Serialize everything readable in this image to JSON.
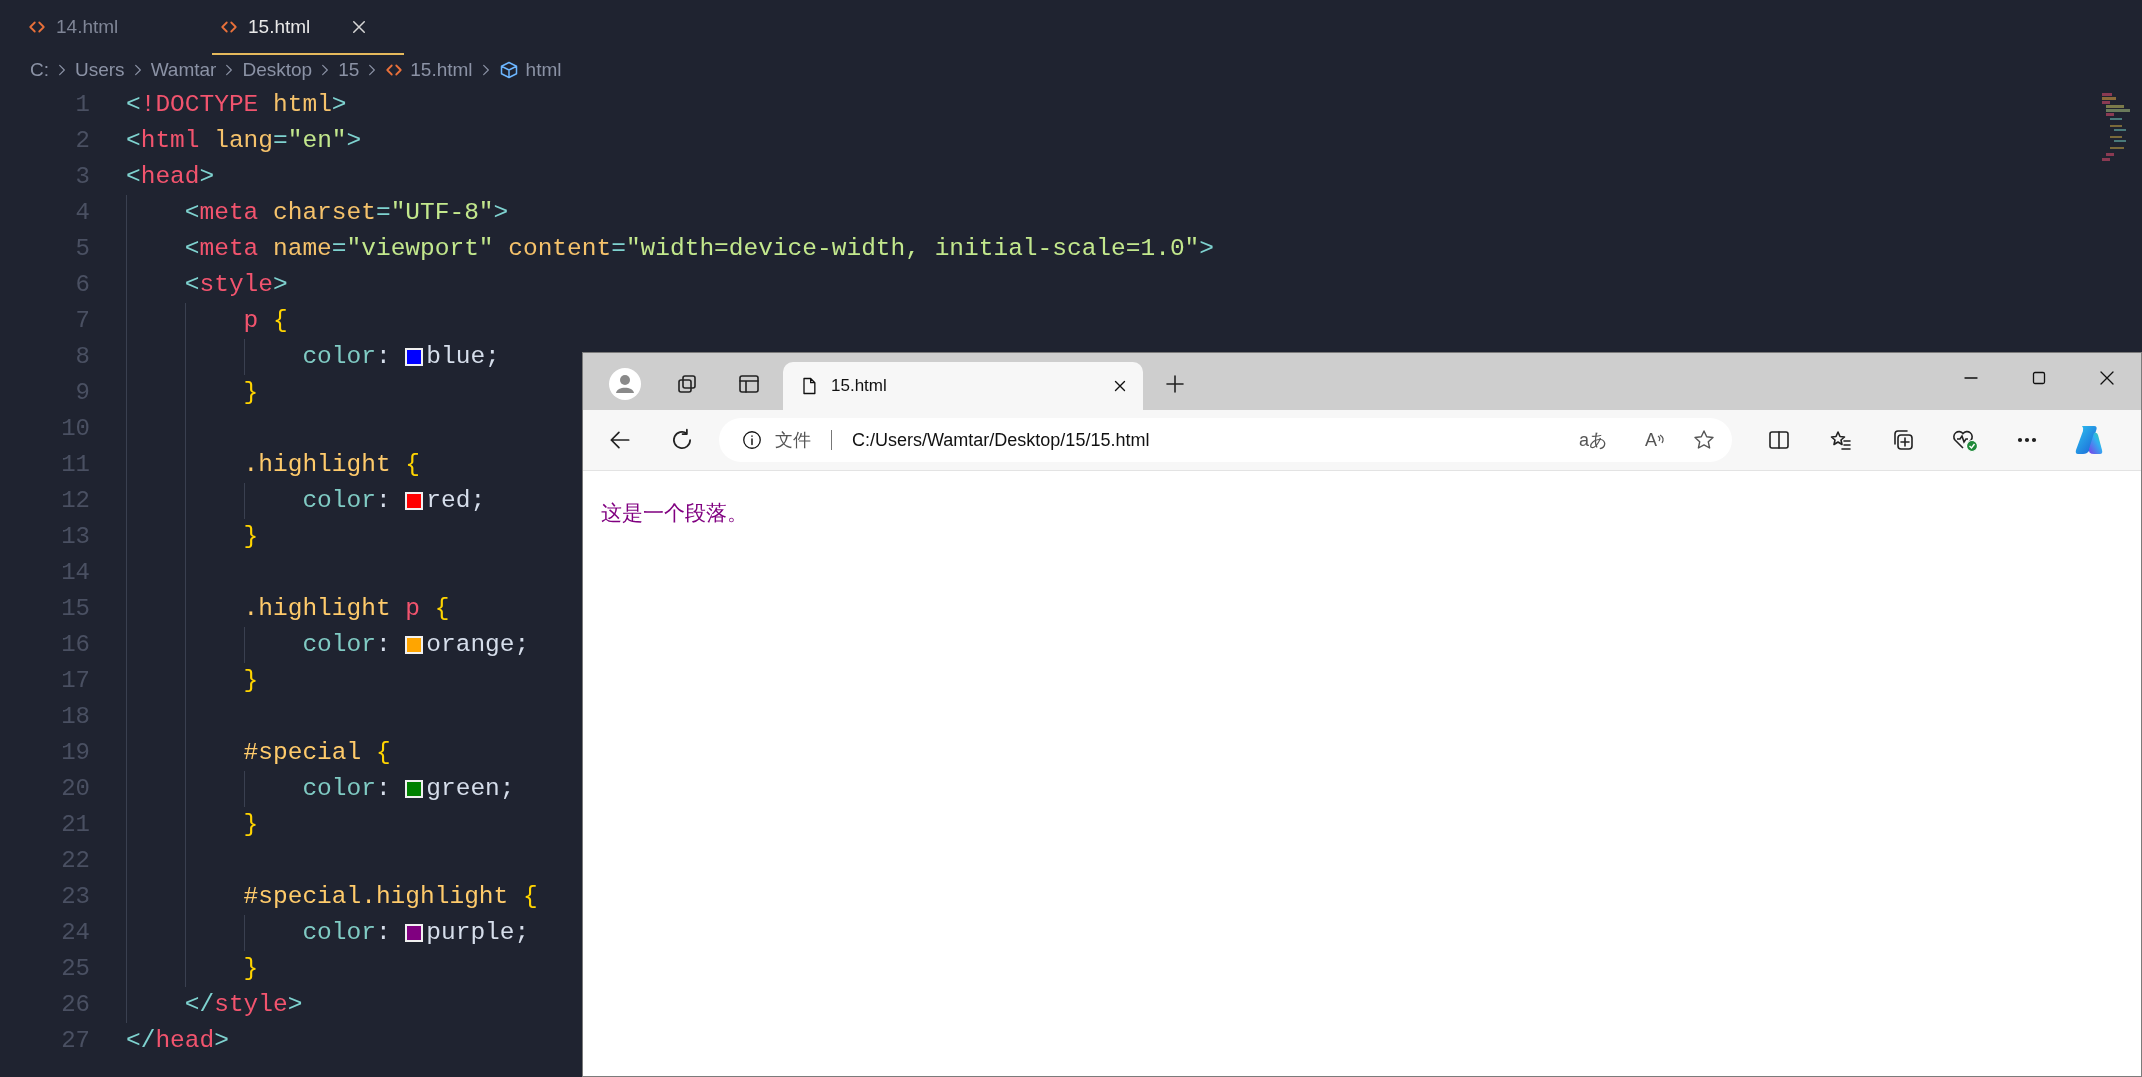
{
  "editor": {
    "tabs": [
      {
        "label": "14.html",
        "selected": false
      },
      {
        "label": "15.html",
        "selected": true
      }
    ],
    "breadcrumb": [
      {
        "label": "C:",
        "kind": "folder"
      },
      {
        "label": "Users",
        "kind": "folder"
      },
      {
        "label": "Wamtar",
        "kind": "folder"
      },
      {
        "label": "Desktop",
        "kind": "folder"
      },
      {
        "label": "15",
        "kind": "folder"
      },
      {
        "label": "15.html",
        "kind": "file"
      },
      {
        "label": "html",
        "kind": "element"
      }
    ],
    "lines": [
      {
        "number": "1",
        "tokens": [
          {
            "kind": "bracket",
            "text": "<"
          },
          {
            "kind": "tag",
            "text": "!DOCTYPE"
          },
          {
            "kind": "attr",
            "text": " html"
          },
          {
            "kind": "bracket",
            "text": ">"
          }
        ]
      },
      {
        "number": "2",
        "tokens": [
          {
            "kind": "bracket",
            "text": "<"
          },
          {
            "kind": "tag",
            "text": "html"
          },
          {
            "kind": "attr",
            "text": " lang"
          },
          {
            "kind": "bracket",
            "text": "="
          },
          {
            "kind": "string",
            "text": "\"en\""
          },
          {
            "kind": "bracket",
            "text": ">"
          }
        ]
      },
      {
        "number": "3",
        "tokens": [
          {
            "kind": "bracket",
            "text": "<"
          },
          {
            "kind": "tag",
            "text": "head"
          },
          {
            "kind": "bracket",
            "text": ">"
          }
        ]
      },
      {
        "number": "4",
        "tokens": [
          {
            "kind": "indent"
          },
          {
            "kind": "bracket",
            "text": "<"
          },
          {
            "kind": "tag",
            "text": "meta"
          },
          {
            "kind": "attr",
            "text": " charset"
          },
          {
            "kind": "bracket",
            "text": "="
          },
          {
            "kind": "string",
            "text": "\"UTF-8\""
          },
          {
            "kind": "bracket",
            "text": ">"
          }
        ]
      },
      {
        "number": "5",
        "tokens": [
          {
            "kind": "indent"
          },
          {
            "kind": "bracket",
            "text": "<"
          },
          {
            "kind": "tag",
            "text": "meta"
          },
          {
            "kind": "attr",
            "text": " name"
          },
          {
            "kind": "bracket",
            "text": "="
          },
          {
            "kind": "string",
            "text": "\"viewport\""
          },
          {
            "kind": "attr",
            "text": " content"
          },
          {
            "kind": "bracket",
            "text": "="
          },
          {
            "kind": "string",
            "text": "\"width=device-width, initial-scale=1.0\""
          },
          {
            "kind": "bracket",
            "text": ">"
          }
        ]
      },
      {
        "number": "6",
        "tokens": [
          {
            "kind": "indent"
          },
          {
            "kind": "bracket",
            "text": "<"
          },
          {
            "kind": "tag",
            "text": "style"
          },
          {
            "kind": "bracket",
            "text": ">"
          }
        ]
      },
      {
        "number": "7",
        "tokens": [
          {
            "kind": "indent"
          },
          {
            "kind": "indent"
          },
          {
            "kind": "tag",
            "text": "p"
          },
          {
            "kind": "brace",
            "text": " {"
          }
        ]
      },
      {
        "number": "8",
        "tokens": [
          {
            "kind": "indent"
          },
          {
            "kind": "indent"
          },
          {
            "kind": "indent"
          },
          {
            "kind": "property",
            "text": "color"
          },
          {
            "kind": "plain",
            "text": ": "
          },
          {
            "kind": "swatch",
            "color": "#0000ff"
          },
          {
            "kind": "plain",
            "text": "blue;"
          }
        ]
      },
      {
        "number": "9",
        "tokens": [
          {
            "kind": "indent"
          },
          {
            "kind": "indent"
          },
          {
            "kind": "brace",
            "text": "}"
          }
        ]
      },
      {
        "number": "10",
        "tokens": [
          {
            "kind": "indent"
          },
          {
            "kind": "indent"
          }
        ]
      },
      {
        "number": "11",
        "tokens": [
          {
            "kind": "indent"
          },
          {
            "kind": "indent"
          },
          {
            "kind": "selector",
            "text": ".highlight"
          },
          {
            "kind": "brace",
            "text": " {"
          }
        ]
      },
      {
        "number": "12",
        "tokens": [
          {
            "kind": "indent"
          },
          {
            "kind": "indent"
          },
          {
            "kind": "indent"
          },
          {
            "kind": "property",
            "text": "color"
          },
          {
            "kind": "plain",
            "text": ": "
          },
          {
            "kind": "swatch",
            "color": "#ff0000"
          },
          {
            "kind": "plain",
            "text": "red;"
          }
        ]
      },
      {
        "number": "13",
        "tokens": [
          {
            "kind": "indent"
          },
          {
            "kind": "indent"
          },
          {
            "kind": "brace",
            "text": "}"
          }
        ]
      },
      {
        "number": "14",
        "tokens": [
          {
            "kind": "indent"
          },
          {
            "kind": "indent"
          }
        ]
      },
      {
        "number": "15",
        "tokens": [
          {
            "kind": "indent"
          },
          {
            "kind": "indent"
          },
          {
            "kind": "selector",
            "text": ".highlight"
          },
          {
            "kind": "tag",
            "text": " p"
          },
          {
            "kind": "brace",
            "text": " {"
          }
        ]
      },
      {
        "number": "16",
        "tokens": [
          {
            "kind": "indent"
          },
          {
            "kind": "indent"
          },
          {
            "kind": "indent"
          },
          {
            "kind": "property",
            "text": "color"
          },
          {
            "kind": "plain",
            "text": ": "
          },
          {
            "kind": "swatch",
            "color": "#ffa500"
          },
          {
            "kind": "plain",
            "text": "orange;"
          }
        ]
      },
      {
        "number": "17",
        "tokens": [
          {
            "kind": "indent"
          },
          {
            "kind": "indent"
          },
          {
            "kind": "brace",
            "text": "}"
          }
        ]
      },
      {
        "number": "18",
        "tokens": [
          {
            "kind": "indent"
          },
          {
            "kind": "indent"
          }
        ]
      },
      {
        "number": "19",
        "tokens": [
          {
            "kind": "indent"
          },
          {
            "kind": "indent"
          },
          {
            "kind": "selector",
            "text": "#special"
          },
          {
            "kind": "brace",
            "text": " {"
          }
        ]
      },
      {
        "number": "20",
        "tokens": [
          {
            "kind": "indent"
          },
          {
            "kind": "indent"
          },
          {
            "kind": "indent"
          },
          {
            "kind": "property",
            "text": "color"
          },
          {
            "kind": "plain",
            "text": ": "
          },
          {
            "kind": "swatch",
            "color": "#008000"
          },
          {
            "kind": "plain",
            "text": "green;"
          }
        ]
      },
      {
        "number": "21",
        "tokens": [
          {
            "kind": "indent"
          },
          {
            "kind": "indent"
          },
          {
            "kind": "brace",
            "text": "}"
          }
        ]
      },
      {
        "number": "22",
        "tokens": [
          {
            "kind": "indent"
          },
          {
            "kind": "indent"
          }
        ]
      },
      {
        "number": "23",
        "tokens": [
          {
            "kind": "indent"
          },
          {
            "kind": "indent"
          },
          {
            "kind": "selector",
            "text": "#special.highlight"
          },
          {
            "kind": "brace",
            "text": " {"
          }
        ]
      },
      {
        "number": "24",
        "tokens": [
          {
            "kind": "indent"
          },
          {
            "kind": "indent"
          },
          {
            "kind": "indent"
          },
          {
            "kind": "property",
            "text": "color"
          },
          {
            "kind": "plain",
            "text": ": "
          },
          {
            "kind": "swatch",
            "color": "#800080"
          },
          {
            "kind": "plain",
            "text": "purple;"
          }
        ]
      },
      {
        "number": "25",
        "tokens": [
          {
            "kind": "indent"
          },
          {
            "kind": "indent"
          },
          {
            "kind": "brace",
            "text": "}"
          }
        ]
      },
      {
        "number": "26",
        "tokens": [
          {
            "kind": "indent"
          },
          {
            "kind": "bracket",
            "text": "</"
          },
          {
            "kind": "tag",
            "text": "style"
          },
          {
            "kind": "bracket",
            "text": ">"
          }
        ]
      },
      {
        "number": "27",
        "tokens": [
          {
            "kind": "bracket",
            "text": "</"
          },
          {
            "kind": "tag",
            "text": "head"
          },
          {
            "kind": "bracket",
            "text": ">"
          }
        ]
      }
    ]
  },
  "browser": {
    "tabs": [
      {
        "title": "15.html",
        "selected": true
      }
    ],
    "address": {
      "scheme_label": "文件",
      "url": "C:/Users/Wamtar/Desktop/15/15.html"
    },
    "translate_label": "aあ",
    "read_aloud_label": "A",
    "page": {
      "paragraph": "这是一个段落。"
    }
  }
}
